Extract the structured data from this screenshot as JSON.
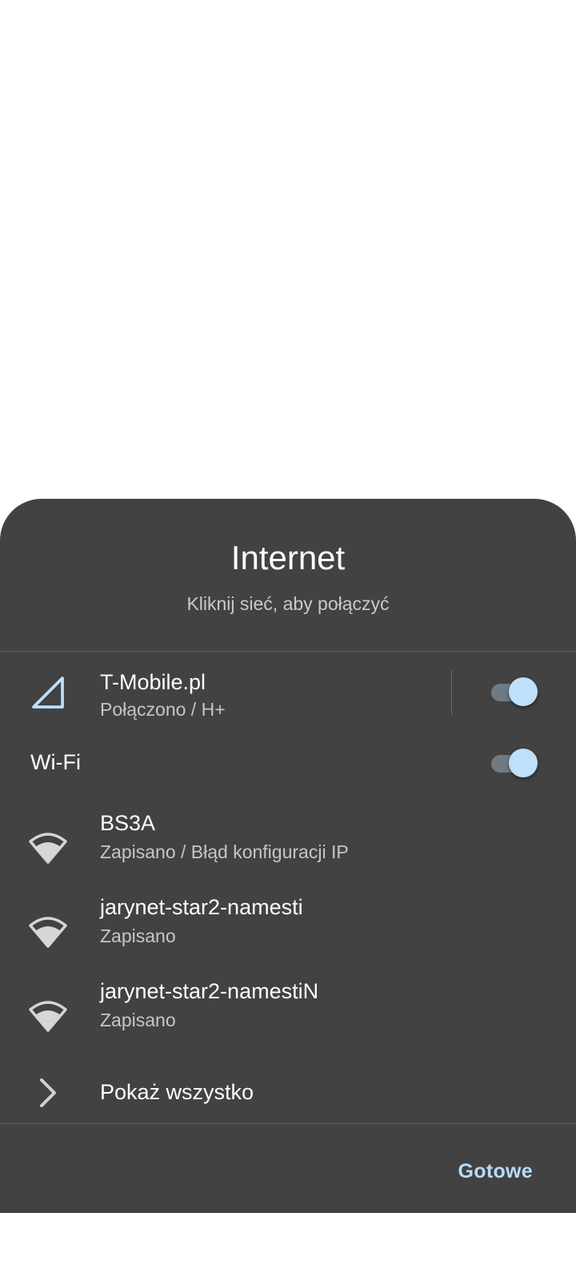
{
  "dialog": {
    "title": "Internet",
    "subtitle": "Kliknij sieć, aby połączyć"
  },
  "mobile": {
    "name": "T-Mobile.pl",
    "status": "Połączono / H+",
    "icon": "cellular-signal-icon",
    "enabled": true
  },
  "wifi": {
    "label": "Wi-Fi",
    "enabled": true,
    "networks": [
      {
        "name": "BS3A",
        "status": "Zapisano / Błąd konfiguracji IP",
        "icon": "wifi-icon"
      },
      {
        "name": "jarynet-star2-namesti",
        "status": "Zapisano",
        "icon": "wifi-icon"
      },
      {
        "name": "jarynet-star2-namestiN",
        "status": "Zapisano",
        "icon": "wifi-icon"
      }
    ],
    "show_all": "Pokaż wszystko"
  },
  "footer": {
    "done_label": "Gotowe"
  },
  "colors": {
    "sheet_bg": "#424242",
    "accent": "#bfe0fb",
    "toggle_track": "#6f7a83"
  }
}
